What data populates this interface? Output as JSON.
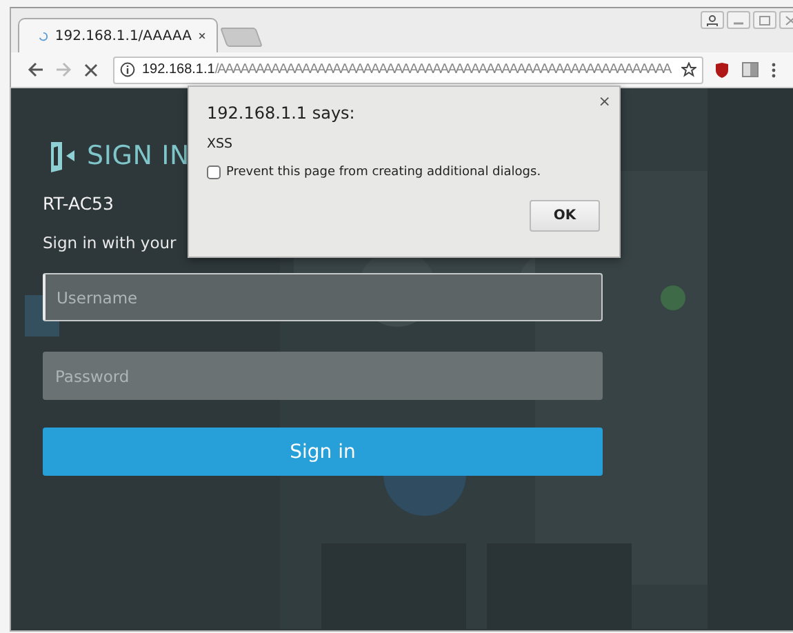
{
  "browser": {
    "tabs": [
      {
        "title": "192.168.1.1/AAAAA",
        "loading": true
      }
    ],
    "navigation": {
      "back_disabled": false,
      "forward_disabled": true
    },
    "address_bar": {
      "host": "192.168.1.1",
      "path": "/AAAAAAAAAAAAAAAAAAAAAAAAAAAAAAAAAAAAAAAAAAAAAAAAAAAAAAAAAAA"
    }
  },
  "page": {
    "heading": "SIGN IN",
    "model": "RT-AC53",
    "instruction": "Sign in with your",
    "username": {
      "placeholder": "Username",
      "focused": true
    },
    "password": {
      "placeholder": "Password",
      "focused": false
    },
    "submit": "Sign in"
  },
  "dialog": {
    "title": "192.168.1.1 says:",
    "close": "×",
    "message": "XSS",
    "checkbox": {
      "label": "Prevent this page from creating additional dialogs.",
      "checked": false
    },
    "button": "OK"
  }
}
